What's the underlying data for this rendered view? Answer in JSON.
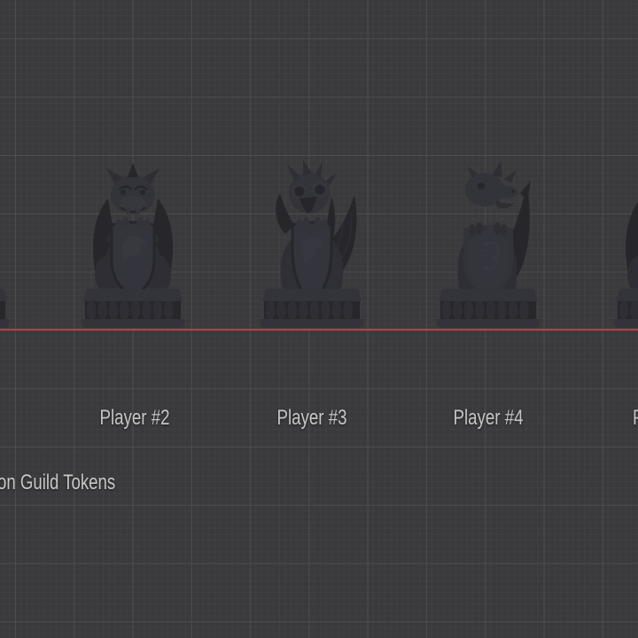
{
  "tokens": {
    "labels": [
      "Player #2",
      "Player #3",
      "Player #4"
    ],
    "partial_right_label": "P",
    "caption": "on Guild Tokens",
    "models": [
      {
        "name": "gargoyle-token-partial-left"
      },
      {
        "name": "gargoyle-shield-token"
      },
      {
        "name": "griffin-shield-token"
      },
      {
        "name": "dragon-shield-token"
      },
      {
        "name": "gargoyle-token-partial-right"
      }
    ]
  },
  "colors": {
    "background": "#3a3a3c",
    "grid_major": "#48484b",
    "grid_minor": "#424245",
    "axis_red": "#9e4a54",
    "label_text": "#c6c6c6",
    "statue_shadow": "#26262b",
    "statue_body": "#2e2e34",
    "statue_front": "#33333a",
    "statue_highlight": "#41414a",
    "shield_face": "#34343c"
  }
}
